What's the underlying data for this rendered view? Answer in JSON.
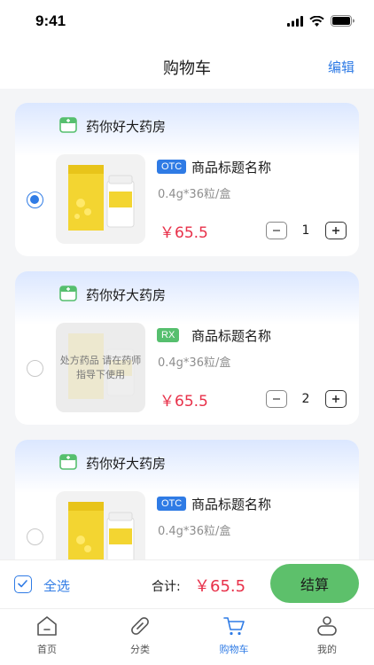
{
  "status": {
    "time": "9:41"
  },
  "nav": {
    "title": "购物车",
    "edit_label": "编辑"
  },
  "stores": [
    {
      "name": "药你好大药房",
      "selected": true,
      "product": {
        "tag": "OTC",
        "title": "商品标题名称",
        "spec": "0.4g*36粒/盒",
        "price": "￥65.5",
        "quantity": "1",
        "prescription": false
      }
    },
    {
      "name": "药你好大药房",
      "selected": false,
      "product": {
        "tag": "RX",
        "title": "商品标题名称",
        "spec": "0.4g*36粒/盒",
        "price": "￥65.5",
        "quantity": "2",
        "prescription": true,
        "overlay_text": "处方药品 请在药师指导下使用"
      }
    },
    {
      "name": "药你好大药房",
      "selected": false,
      "product": {
        "tag": "OTC",
        "title": "商品标题名称",
        "spec": "0.4g*36粒/盒",
        "prescription": false
      }
    }
  ],
  "footer": {
    "select_all_label": "全选",
    "total_label": "合计:",
    "total_value": "￥65.5",
    "checkout_label": "结算"
  },
  "tabs": [
    {
      "label": "首页",
      "icon": "home-icon",
      "active": false
    },
    {
      "label": "分类",
      "icon": "pill-icon",
      "active": false
    },
    {
      "label": "购物车",
      "icon": "cart-icon",
      "active": true
    },
    {
      "label": "我的",
      "icon": "profile-icon",
      "active": false
    }
  ],
  "colors": {
    "accent": "#2f7be5",
    "price": "#e8314a",
    "checkout": "#5dc06b",
    "rx_tag": "#56bf6e",
    "store_icon": "#56bf6e"
  }
}
